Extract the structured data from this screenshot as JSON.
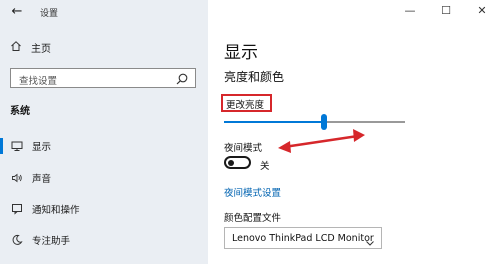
{
  "titlebar": {
    "back_glyph": "←",
    "app_title": "设置",
    "minimize_glyph": "—",
    "maximize_glyph": "☐",
    "close_glyph": "✕"
  },
  "sidebar": {
    "home_label": "主页",
    "search_placeholder": "查找设置",
    "section_label": "系统",
    "items": [
      {
        "label": "显示",
        "icon": "monitor-icon",
        "active": true
      },
      {
        "label": "声音",
        "icon": "speaker-icon",
        "active": false
      },
      {
        "label": "通知和操作",
        "icon": "notification-icon",
        "active": false
      },
      {
        "label": "专注助手",
        "icon": "moon-icon",
        "active": false
      }
    ]
  },
  "main": {
    "page_title": "显示",
    "section_title": "亮度和颜色",
    "brightness_label": "更改亮度",
    "brightness_level_percent": 55,
    "night_mode_label": "夜间模式",
    "night_mode_state": "关",
    "night_mode_settings_link": "夜间模式设置",
    "color_profile_label": "颜色配置文件",
    "color_profile_value": "Lenovo ThinkPad LCD Monitor"
  },
  "colors": {
    "accent": "#0078d7",
    "annotation_red": "#d6272b",
    "link": "#0063b1",
    "sidebar_bg": "#eaeef3"
  }
}
